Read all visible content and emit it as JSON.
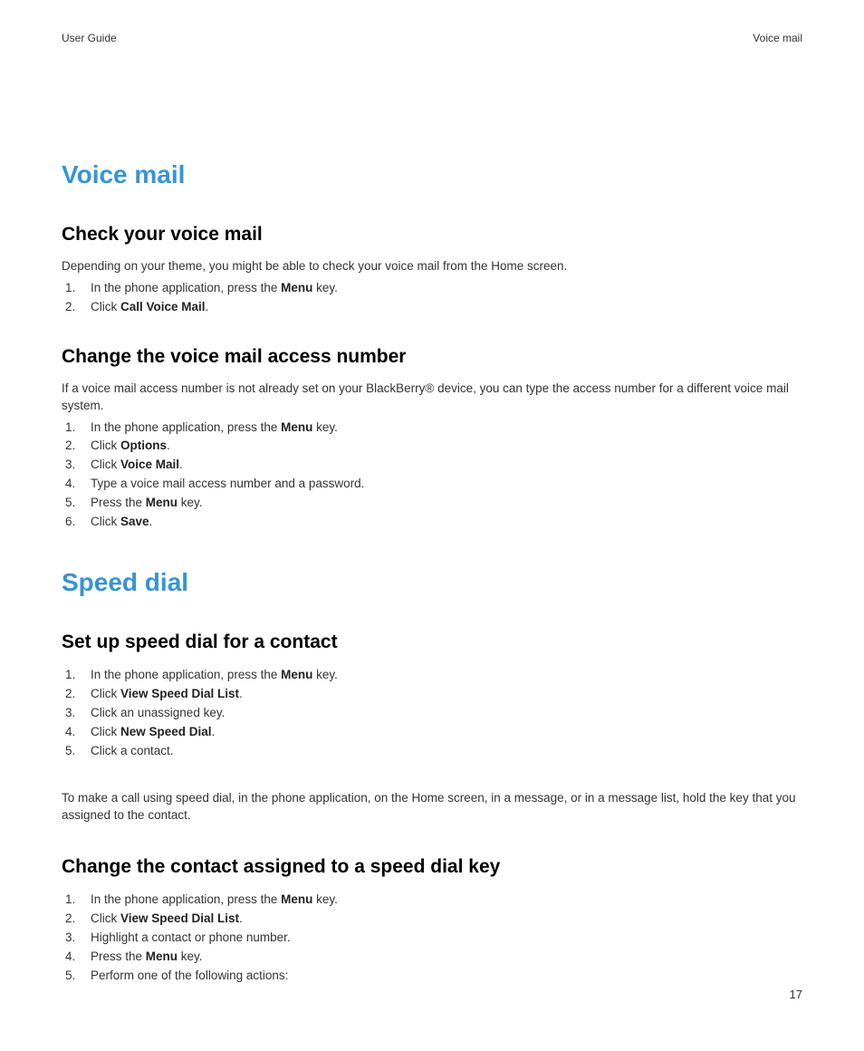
{
  "header": {
    "left": "User Guide",
    "right": "Voice mail"
  },
  "sections": [
    {
      "title": "Voice mail",
      "subsections": [
        {
          "title": "Check your voice mail",
          "intro": "Depending on your theme, you might be able to check your voice mail from the Home screen.",
          "steps": [
            [
              {
                "t": "In the phone application, press the "
              },
              {
                "t": "Menu",
                "b": true
              },
              {
                "t": " key."
              }
            ],
            [
              {
                "t": "Click "
              },
              {
                "t": "Call Voice Mail",
                "b": true
              },
              {
                "t": "."
              }
            ]
          ]
        },
        {
          "title": "Change the voice mail access number",
          "intro": "If a voice mail access number is not already set on your BlackBerry® device, you can type the access number for a different voice mail system.",
          "steps": [
            [
              {
                "t": "In the phone application, press the "
              },
              {
                "t": "Menu",
                "b": true
              },
              {
                "t": " key."
              }
            ],
            [
              {
                "t": "Click "
              },
              {
                "t": "Options",
                "b": true
              },
              {
                "t": "."
              }
            ],
            [
              {
                "t": "Click "
              },
              {
                "t": "Voice Mail",
                "b": true
              },
              {
                "t": "."
              }
            ],
            [
              {
                "t": "Type a voice mail access number and a password."
              }
            ],
            [
              {
                "t": "Press the "
              },
              {
                "t": "Menu",
                "b": true
              },
              {
                "t": " key."
              }
            ],
            [
              {
                "t": "Click "
              },
              {
                "t": "Save",
                "b": true
              },
              {
                "t": "."
              }
            ]
          ]
        }
      ]
    },
    {
      "title": "Speed dial",
      "subsections": [
        {
          "title": "Set up speed dial for a contact",
          "steps": [
            [
              {
                "t": "In the phone application, press the "
              },
              {
                "t": "Menu",
                "b": true
              },
              {
                "t": " key."
              }
            ],
            [
              {
                "t": "Click "
              },
              {
                "t": "View Speed Dial List",
                "b": true
              },
              {
                "t": "."
              }
            ],
            [
              {
                "t": "Click an unassigned key."
              }
            ],
            [
              {
                "t": "Click "
              },
              {
                "t": "New Speed Dial",
                "b": true
              },
              {
                "t": "."
              }
            ],
            [
              {
                "t": "Click a contact."
              }
            ]
          ],
          "after": "To make a call using speed dial, in the phone application, on the Home screen, in a message, or in a message list, hold the key that you assigned to the contact."
        },
        {
          "title": "Change the contact assigned to a speed dial key",
          "steps": [
            [
              {
                "t": "In the phone application, press the "
              },
              {
                "t": "Menu",
                "b": true
              },
              {
                "t": " key."
              }
            ],
            [
              {
                "t": "Click "
              },
              {
                "t": "View Speed Dial List",
                "b": true
              },
              {
                "t": "."
              }
            ],
            [
              {
                "t": "Highlight a contact or phone number."
              }
            ],
            [
              {
                "t": "Press the "
              },
              {
                "t": "Menu",
                "b": true
              },
              {
                "t": " key."
              }
            ],
            [
              {
                "t": "Perform one of the following actions:"
              }
            ]
          ]
        }
      ]
    }
  ],
  "page_number": "17"
}
